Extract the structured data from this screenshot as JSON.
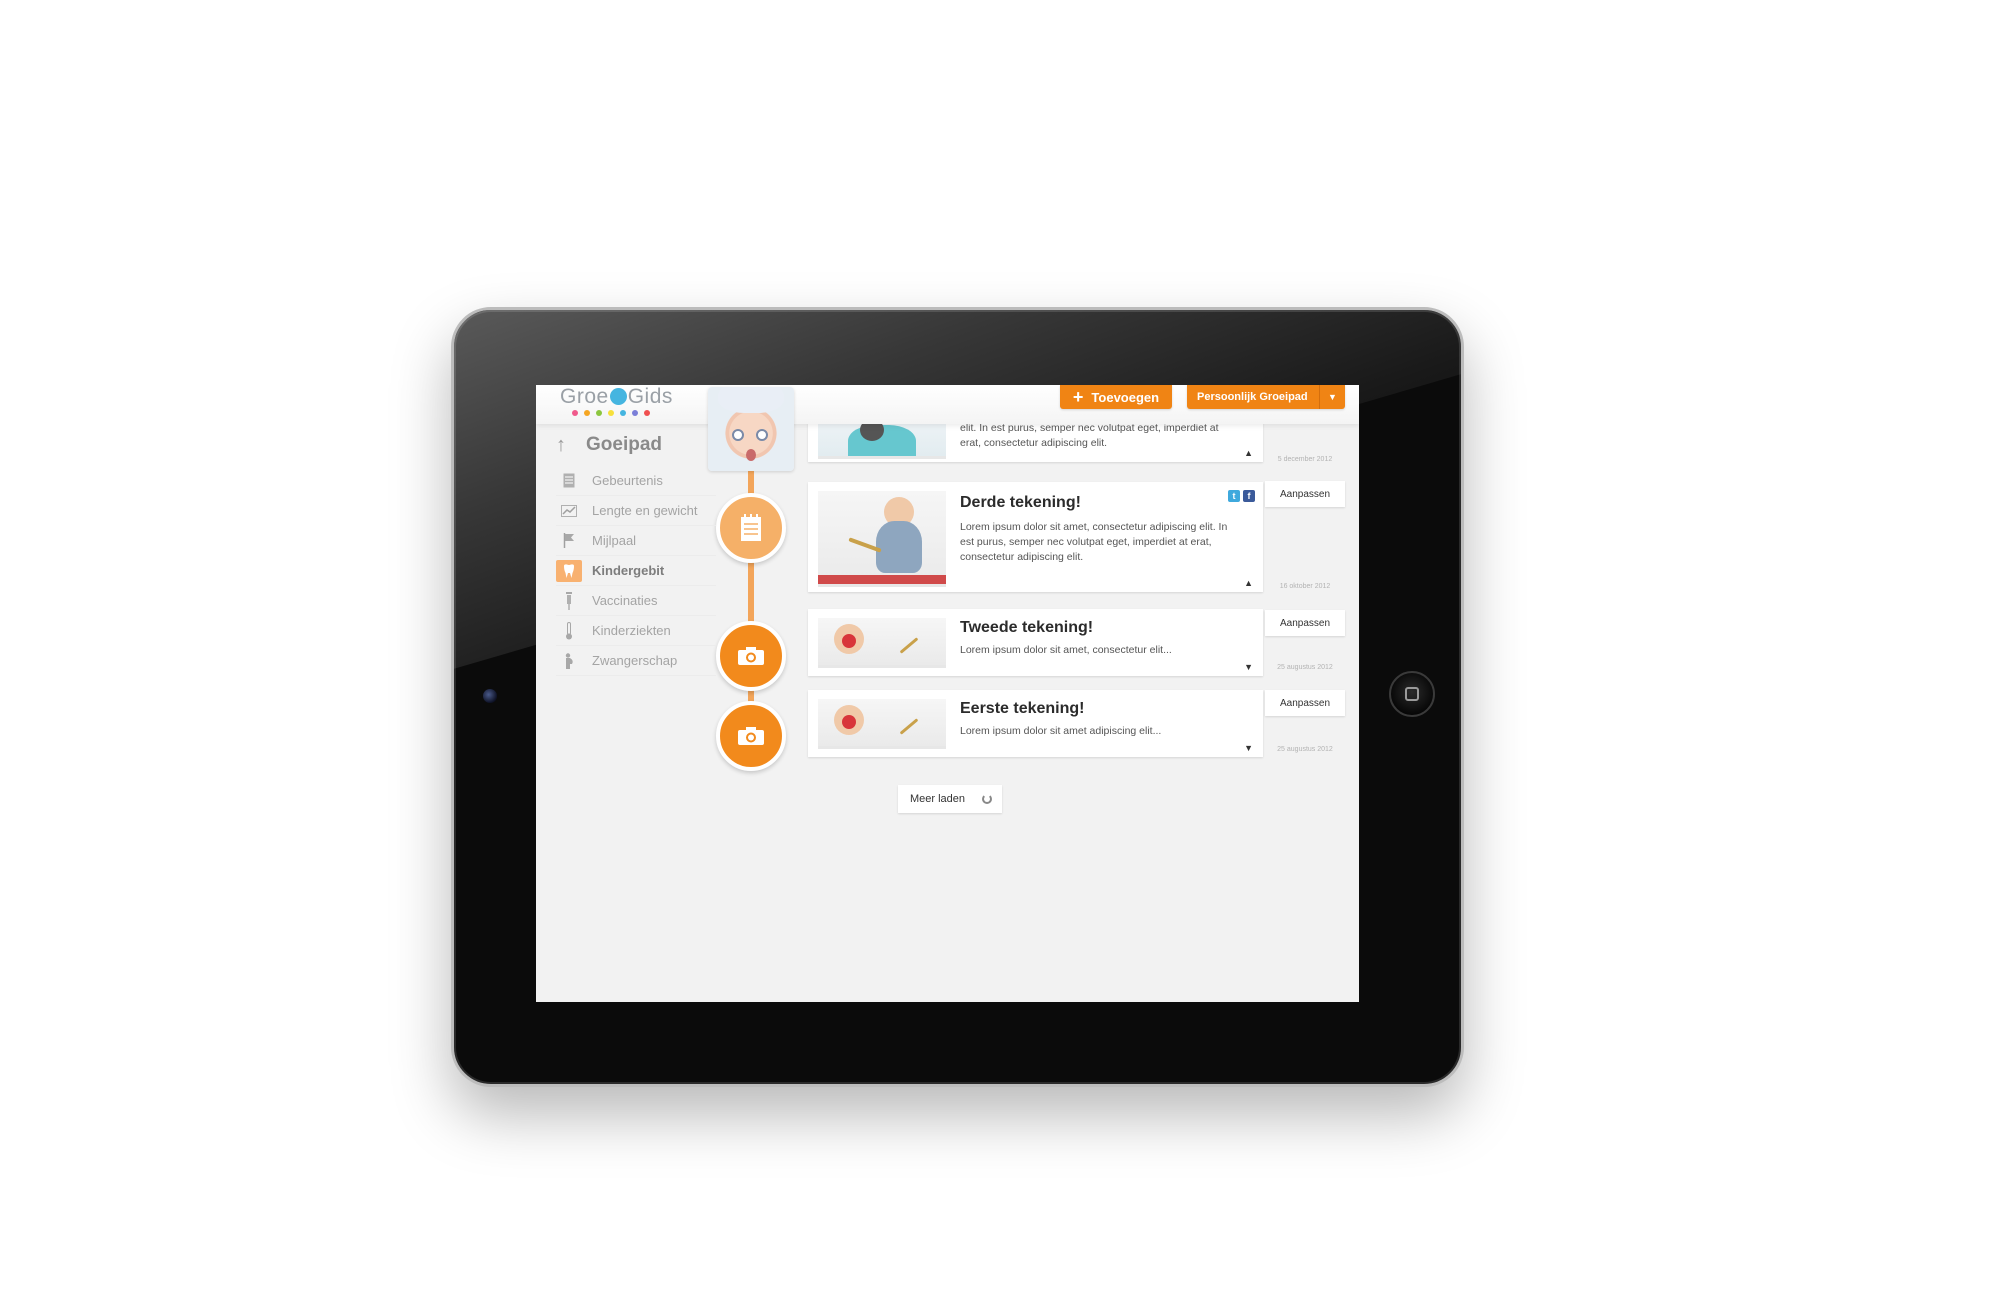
{
  "logo": {
    "prefix": "Groe",
    "suffix": "Gids",
    "dot_colors": [
      "#f05a8c",
      "#f5a623",
      "#8cc63f",
      "#f7e03c",
      "#45b5e0",
      "#7b7fd8",
      "#f05050"
    ]
  },
  "header": {
    "add_label": "Toevoegen",
    "add_icon": "+",
    "profile_label": "Persoonlijk Groeipad",
    "profile_caret": "▼"
  },
  "sidebar": {
    "back_arrow": "↑",
    "title": "Goeipad",
    "items": [
      {
        "label": "Gebeurtenis",
        "icon": "notepad-icon"
      },
      {
        "label": "Lengte en gewicht",
        "icon": "chart-icon"
      },
      {
        "label": "Mijlpaal",
        "icon": "flag-icon"
      },
      {
        "label": "Kindergebit",
        "icon": "tooth-icon",
        "active": true
      },
      {
        "label": "Vaccinaties",
        "icon": "syringe-icon"
      },
      {
        "label": "Kinderziekten",
        "icon": "thermometer-icon"
      },
      {
        "label": "Zwangerschap",
        "icon": "pregnancy-icon"
      }
    ]
  },
  "posts": [
    {
      "title": "",
      "text": "elit. In est purus, semper nec volutpat eget, imperdiet at erat, consectetur adipiscing elit.",
      "date": "5 december 2012",
      "toggle": "▲"
    },
    {
      "title": "Derde tekening!",
      "text": "Lorem ipsum dolor sit amet, consectetur adipiscing elit. In est purus, semper nec volutpat eget, imperdiet at erat, consectetur adipiscing elit.",
      "date": "16 oktober 2012",
      "toggle": "▲",
      "edit": "Aanpassen",
      "social": [
        "t",
        "f"
      ]
    },
    {
      "title": "Tweede tekening!",
      "text": "Lorem ipsum dolor sit amet, consectetur elit...",
      "date": "25 augustus 2012",
      "toggle": "▼",
      "edit": "Aanpassen"
    },
    {
      "title": "Eerste tekening!",
      "text": "Lorem ipsum dolor sit amet adipiscing elit...",
      "date": "25 augustus 2012",
      "toggle": "▼",
      "edit": "Aanpassen"
    }
  ],
  "load_more": "Meer laden",
  "colors": {
    "accent": "#f08414",
    "accent_light": "#f5b068",
    "twitter": "#3fa9dd",
    "facebook": "#3b5a9a"
  }
}
